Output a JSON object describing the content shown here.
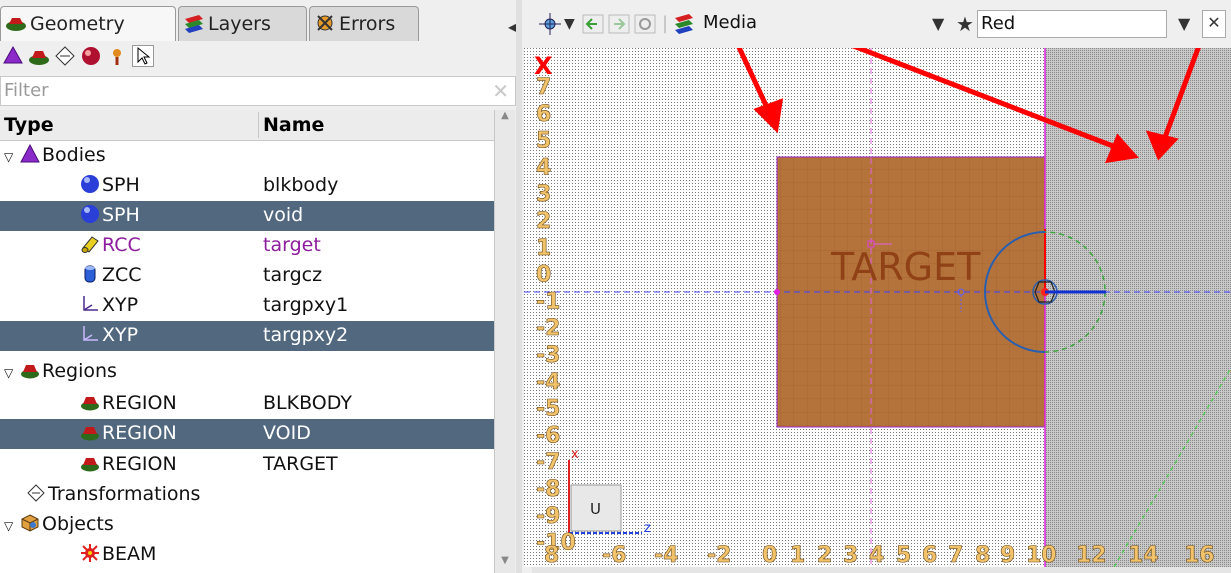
{
  "left_panel": {
    "tabs": [
      {
        "label": "Geometry",
        "icon": "geometry-icon",
        "active": true
      },
      {
        "label": "Layers",
        "icon": "layers-icon",
        "active": false
      },
      {
        "label": "Errors",
        "icon": "errors-icon",
        "active": false
      }
    ],
    "toolbar_icons": [
      "body-icon",
      "region-icon",
      "transformation-icon",
      "material-icon",
      "object-icon",
      "select-arrow-icon"
    ],
    "filter": {
      "placeholder": "Filter",
      "value": ""
    },
    "columns": {
      "type": "Type",
      "name": "Name"
    },
    "tree": [
      {
        "type": "Bodies",
        "name": "",
        "level": 0,
        "expanded": true,
        "icon": "bodies-icon",
        "selected": false
      },
      {
        "type": "SPH",
        "name": "blkbody",
        "level": 1,
        "icon": "sphere-icon",
        "selected": false
      },
      {
        "type": "SPH",
        "name": "void",
        "level": 1,
        "icon": "sphere-icon",
        "selected": true
      },
      {
        "type": "RCC",
        "name": "target",
        "level": 1,
        "icon": "cylinder-icon",
        "selected": false,
        "highlight": true
      },
      {
        "type": "ZCC",
        "name": "targcz",
        "level": 1,
        "icon": "infinite-cylinder-icon",
        "selected": false
      },
      {
        "type": "XYP",
        "name": "targpxy1",
        "level": 1,
        "icon": "plane-icon",
        "selected": false
      },
      {
        "type": "XYP",
        "name": "targpxy2",
        "level": 1,
        "icon": "plane-icon",
        "selected": true
      },
      {
        "type": "Regions",
        "name": "",
        "level": 0,
        "expanded": true,
        "icon": "regions-icon",
        "selected": false
      },
      {
        "type": "REGION",
        "name": "BLKBODY",
        "level": 1,
        "icon": "region-icon",
        "selected": false
      },
      {
        "type": "REGION",
        "name": "VOID",
        "level": 1,
        "icon": "region-icon",
        "selected": true
      },
      {
        "type": "REGION",
        "name": "TARGET",
        "level": 1,
        "icon": "region-icon",
        "selected": false
      },
      {
        "type": "Transformations",
        "name": "",
        "level": 0,
        "expanded": false,
        "icon": "transformation-icon",
        "selected": false
      },
      {
        "type": "Objects",
        "name": "",
        "level": 0,
        "expanded": true,
        "icon": "objects-icon",
        "selected": false
      },
      {
        "type": "BEAM",
        "name": "",
        "level": 1,
        "icon": "beam-icon",
        "selected": false
      }
    ]
  },
  "viewport": {
    "toolbar": {
      "layer_combo": "Media",
      "color_combo": "Red",
      "icons": [
        "move-icon",
        "dropdown-icon",
        "back-icon",
        "forward-icon",
        "refresh-icon",
        "media-icon",
        "star-icon",
        "close-icon"
      ]
    },
    "axis": {
      "left_label": "X",
      "left_ticks": [
        "7",
        "6",
        "5",
        "4",
        "3",
        "2",
        "1",
        "0",
        "-1",
        "-2",
        "-3",
        "-4",
        "-5",
        "-6",
        "-7",
        "-8",
        "-9",
        "-10"
      ],
      "bottom_ticks": [
        "8",
        "-6",
        "-4",
        "-2",
        "0",
        "1",
        "2",
        "3",
        "4",
        "5",
        "6",
        "7",
        "8",
        "9",
        "10",
        "12",
        "14",
        "16"
      ]
    },
    "target_label": "TARGET",
    "orientation": {
      "up_label": "U",
      "x_label": "x",
      "z_label": "z"
    },
    "colors": {
      "target_fill": "#b5733c",
      "annotation_arrows": "#ff0000",
      "boundary_line": "#e020e0",
      "selection": "#52687f"
    }
  }
}
